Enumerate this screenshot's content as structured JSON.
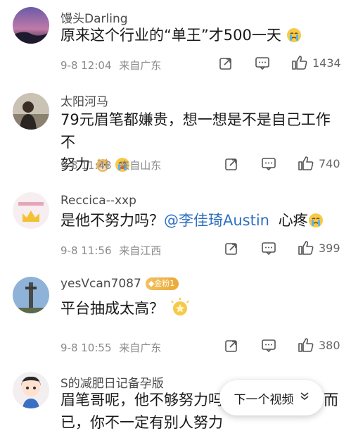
{
  "comments": [
    {
      "name": "馒头Darling",
      "text": "原来这个行业的“单王”才500一天",
      "time": "9-8 12:04",
      "location": "来自广东",
      "likes": "1434",
      "emoji": "crying-face"
    },
    {
      "name": "太阳河马",
      "text_line1": "79元眉笔都嫌贵，想一想是不是自己工作不",
      "text_line2": "努力",
      "time": "9-8 11:48",
      "location": "来自山东",
      "likes": "740",
      "emoji": "doge-and-crying-face"
    },
    {
      "name": "Reccica--xxp",
      "text_prefix": "是他不努力吗？",
      "mention": "@李佳琦Austin",
      "text_suffix": "心疼",
      "time": "9-8 11:56",
      "location": "来自江西",
      "likes": "399",
      "emoji": "crying-face"
    },
    {
      "name": "yesVcan7087",
      "badge": "金粉1",
      "text": "平台抽成太高？",
      "time": "9-8 10:55",
      "location": "来自广东",
      "likes": "380",
      "emoji": "gold-badge-sticker"
    },
    {
      "name": "S的减肥日记备孕版",
      "text_line1": "眉笔哥呢，他不够努力吗",
      "text_line1_tail": "而",
      "text_line2": "已，你不一定有别人努力"
    }
  ],
  "next_video": {
    "label": "下一个视频",
    "icon": "double-chevron-down-icon"
  },
  "colors": {
    "mention": "#2e6fbf",
    "meta": "#8a8a8a",
    "badge": "#eaa93a"
  }
}
